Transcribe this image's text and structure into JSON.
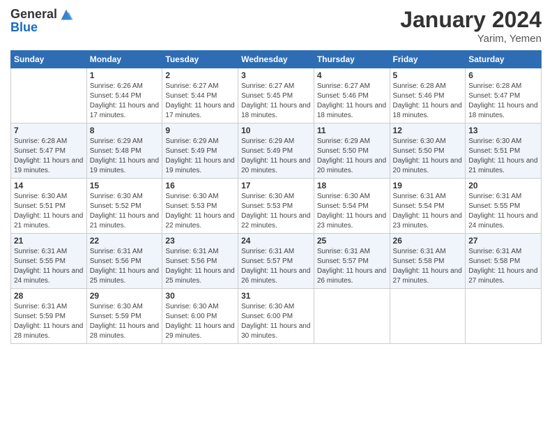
{
  "header": {
    "logo_general": "General",
    "logo_blue": "Blue",
    "month": "January 2024",
    "location": "Yarim, Yemen"
  },
  "weekdays": [
    "Sunday",
    "Monday",
    "Tuesday",
    "Wednesday",
    "Thursday",
    "Friday",
    "Saturday"
  ],
  "weeks": [
    [
      {
        "day": "",
        "info": ""
      },
      {
        "day": "1",
        "info": "Sunrise: 6:26 AM\nSunset: 5:44 PM\nDaylight: 11 hours and 17 minutes."
      },
      {
        "day": "2",
        "info": "Sunrise: 6:27 AM\nSunset: 5:44 PM\nDaylight: 11 hours and 17 minutes."
      },
      {
        "day": "3",
        "info": "Sunrise: 6:27 AM\nSunset: 5:45 PM\nDaylight: 11 hours and 18 minutes."
      },
      {
        "day": "4",
        "info": "Sunrise: 6:27 AM\nSunset: 5:46 PM\nDaylight: 11 hours and 18 minutes."
      },
      {
        "day": "5",
        "info": "Sunrise: 6:28 AM\nSunset: 5:46 PM\nDaylight: 11 hours and 18 minutes."
      },
      {
        "day": "6",
        "info": "Sunrise: 6:28 AM\nSunset: 5:47 PM\nDaylight: 11 hours and 18 minutes."
      }
    ],
    [
      {
        "day": "7",
        "info": "Sunrise: 6:28 AM\nSunset: 5:47 PM\nDaylight: 11 hours and 19 minutes."
      },
      {
        "day": "8",
        "info": "Sunrise: 6:29 AM\nSunset: 5:48 PM\nDaylight: 11 hours and 19 minutes."
      },
      {
        "day": "9",
        "info": "Sunrise: 6:29 AM\nSunset: 5:49 PM\nDaylight: 11 hours and 19 minutes."
      },
      {
        "day": "10",
        "info": "Sunrise: 6:29 AM\nSunset: 5:49 PM\nDaylight: 11 hours and 20 minutes."
      },
      {
        "day": "11",
        "info": "Sunrise: 6:29 AM\nSunset: 5:50 PM\nDaylight: 11 hours and 20 minutes."
      },
      {
        "day": "12",
        "info": "Sunrise: 6:30 AM\nSunset: 5:50 PM\nDaylight: 11 hours and 20 minutes."
      },
      {
        "day": "13",
        "info": "Sunrise: 6:30 AM\nSunset: 5:51 PM\nDaylight: 11 hours and 21 minutes."
      }
    ],
    [
      {
        "day": "14",
        "info": "Sunrise: 6:30 AM\nSunset: 5:51 PM\nDaylight: 11 hours and 21 minutes."
      },
      {
        "day": "15",
        "info": "Sunrise: 6:30 AM\nSunset: 5:52 PM\nDaylight: 11 hours and 21 minutes."
      },
      {
        "day": "16",
        "info": "Sunrise: 6:30 AM\nSunset: 5:53 PM\nDaylight: 11 hours and 22 minutes."
      },
      {
        "day": "17",
        "info": "Sunrise: 6:30 AM\nSunset: 5:53 PM\nDaylight: 11 hours and 22 minutes."
      },
      {
        "day": "18",
        "info": "Sunrise: 6:30 AM\nSunset: 5:54 PM\nDaylight: 11 hours and 23 minutes."
      },
      {
        "day": "19",
        "info": "Sunrise: 6:31 AM\nSunset: 5:54 PM\nDaylight: 11 hours and 23 minutes."
      },
      {
        "day": "20",
        "info": "Sunrise: 6:31 AM\nSunset: 5:55 PM\nDaylight: 11 hours and 24 minutes."
      }
    ],
    [
      {
        "day": "21",
        "info": "Sunrise: 6:31 AM\nSunset: 5:55 PM\nDaylight: 11 hours and 24 minutes."
      },
      {
        "day": "22",
        "info": "Sunrise: 6:31 AM\nSunset: 5:56 PM\nDaylight: 11 hours and 25 minutes."
      },
      {
        "day": "23",
        "info": "Sunrise: 6:31 AM\nSunset: 5:56 PM\nDaylight: 11 hours and 25 minutes."
      },
      {
        "day": "24",
        "info": "Sunrise: 6:31 AM\nSunset: 5:57 PM\nDaylight: 11 hours and 26 minutes."
      },
      {
        "day": "25",
        "info": "Sunrise: 6:31 AM\nSunset: 5:57 PM\nDaylight: 11 hours and 26 minutes."
      },
      {
        "day": "26",
        "info": "Sunrise: 6:31 AM\nSunset: 5:58 PM\nDaylight: 11 hours and 27 minutes."
      },
      {
        "day": "27",
        "info": "Sunrise: 6:31 AM\nSunset: 5:58 PM\nDaylight: 11 hours and 27 minutes."
      }
    ],
    [
      {
        "day": "28",
        "info": "Sunrise: 6:31 AM\nSunset: 5:59 PM\nDaylight: 11 hours and 28 minutes."
      },
      {
        "day": "29",
        "info": "Sunrise: 6:30 AM\nSunset: 5:59 PM\nDaylight: 11 hours and 28 minutes."
      },
      {
        "day": "30",
        "info": "Sunrise: 6:30 AM\nSunset: 6:00 PM\nDaylight: 11 hours and 29 minutes."
      },
      {
        "day": "31",
        "info": "Sunrise: 6:30 AM\nSunset: 6:00 PM\nDaylight: 11 hours and 30 minutes."
      },
      {
        "day": "",
        "info": ""
      },
      {
        "day": "",
        "info": ""
      },
      {
        "day": "",
        "info": ""
      }
    ]
  ]
}
